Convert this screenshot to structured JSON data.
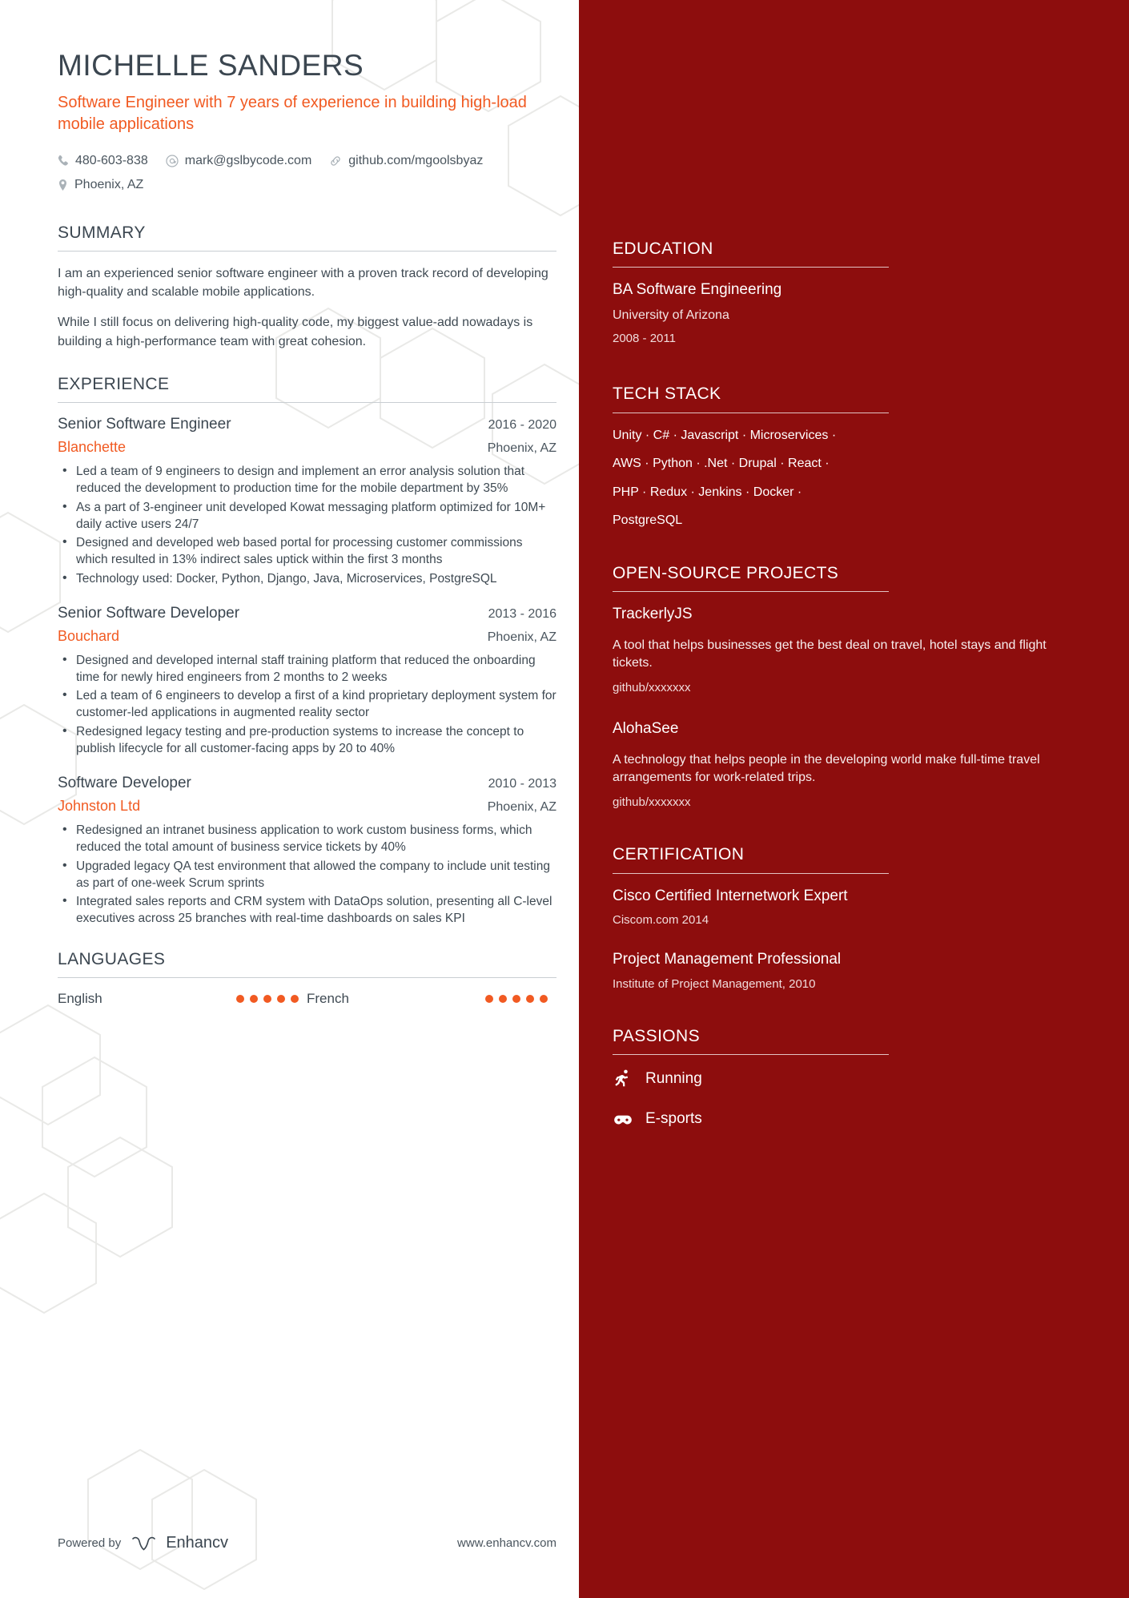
{
  "header": {
    "name": "MICHELLE SANDERS",
    "headline": "Software Engineer with 7 years of experience in building high-load mobile applications",
    "contacts": [
      {
        "icon": "phone-icon",
        "text": "480-603-838"
      },
      {
        "icon": "email-icon",
        "text": "mark@gslbycode.com"
      },
      {
        "icon": "link-icon",
        "text": "github.com/mgoolsbyaz"
      },
      {
        "icon": "location-pin-icon",
        "text": "Phoenix, AZ"
      }
    ]
  },
  "summary": {
    "title": "SUMMARY",
    "paragraphs": [
      "I am an experienced senior software engineer with a proven track record of developing high-quality and scalable mobile applications.",
      "While I still focus on delivering high-quality code, my biggest value-add nowadays is building a high-performance team with great cohesion."
    ]
  },
  "experience": {
    "title": "EXPERIENCE",
    "jobs": [
      {
        "title": "Senior Software Engineer",
        "date": "2016 - 2020",
        "company": "Blanchette",
        "location": "Phoenix, AZ",
        "bullets": [
          "Led a team of 9 engineers to design and implement an error analysis solution that reduced the development to production time for the mobile department by 35%",
          "As a part of 3-engineer unit developed Kowat messaging platform optimized for 10M+ daily active users 24/7",
          "Designed and developed web based portal for processing customer commissions which resulted in 13% indirect sales uptick within the first 3 months",
          "Technology used: Docker, Python, Django, Java, Microservices, PostgreSQL"
        ]
      },
      {
        "title": "Senior Software Developer",
        "date": "2013 - 2016",
        "company": "Bouchard",
        "location": "Phoenix, AZ",
        "bullets": [
          "Designed and developed internal staff training platform that reduced the onboarding time for newly hired engineers from 2 months to 2 weeks",
          "Led a team of 6 engineers to develop a first of a kind proprietary deployment system for customer-led applications in augmented reality sector",
          "Redesigned legacy testing and pre-production systems to increase the concept to publish lifecycle for all customer-facing apps by 20 to 40%"
        ]
      },
      {
        "title": "Software Developer",
        "date": "2010 - 2013",
        "company": "Johnston Ltd",
        "location": "Phoenix, AZ",
        "bullets": [
          "Redesigned an intranet business application to work custom business forms, which reduced the total amount of business service tickets by 40%",
          "Upgraded legacy QA test environment that allowed the company to include unit testing as part of one-week Scrum sprints",
          "Integrated sales reports and CRM system with DataOps solution, presenting all C-level executives across 25 branches with real-time dashboards on sales KPI"
        ]
      }
    ]
  },
  "languages": {
    "title": "LANGUAGES",
    "items": [
      {
        "name": "English",
        "level": 5,
        "max": 5
      },
      {
        "name": "French",
        "level": 5,
        "max": 5
      }
    ]
  },
  "education": {
    "title": "EDUCATION",
    "items": [
      {
        "degree": "BA Software Engineering",
        "school": "University of Arizona",
        "years": "2008 - 2011"
      }
    ]
  },
  "tech_stack": {
    "title": "TECH STACK",
    "lines": [
      "Unity ·  C#  · Javascript · Microservices ·",
      "AWS · Python · .Net · Drupal · React ·",
      "PHP · Redux · Jenkins · Docker ·",
      "PostgreSQL"
    ]
  },
  "open_source": {
    "title": "OPEN-SOURCE PROJECTS",
    "items": [
      {
        "name": "TrackerlyJS",
        "description": "A tool that helps businesses get the best deal on travel, hotel stays and flight tickets.",
        "link": "github/xxxxxxx"
      },
      {
        "name": "AlohaSee",
        "description": "A technology that helps people in the developing world make full-time travel arrangements for work-related trips.",
        "link": "github/xxxxxxx"
      }
    ]
  },
  "certification": {
    "title": "CERTIFICATION",
    "items": [
      {
        "name": "Cisco Certified Internetwork Expert",
        "issuer": "Ciscom.com 2014"
      },
      {
        "name": "Project Management Professional",
        "issuer": "Institute of Project Management, 2010"
      }
    ]
  },
  "passions": {
    "title": "PASSIONS",
    "items": [
      {
        "icon": "running-icon",
        "label": "Running"
      },
      {
        "icon": "gamepad-icon",
        "label": "E-sports"
      }
    ]
  },
  "footer": {
    "powered_by": "Powered by",
    "brand": "Enhancv",
    "url": "www.enhancv.com"
  },
  "colors": {
    "accent_orange": "#f15a22",
    "sidebar_red": "#8d0d0d",
    "heading_gray": "#3b4650"
  }
}
